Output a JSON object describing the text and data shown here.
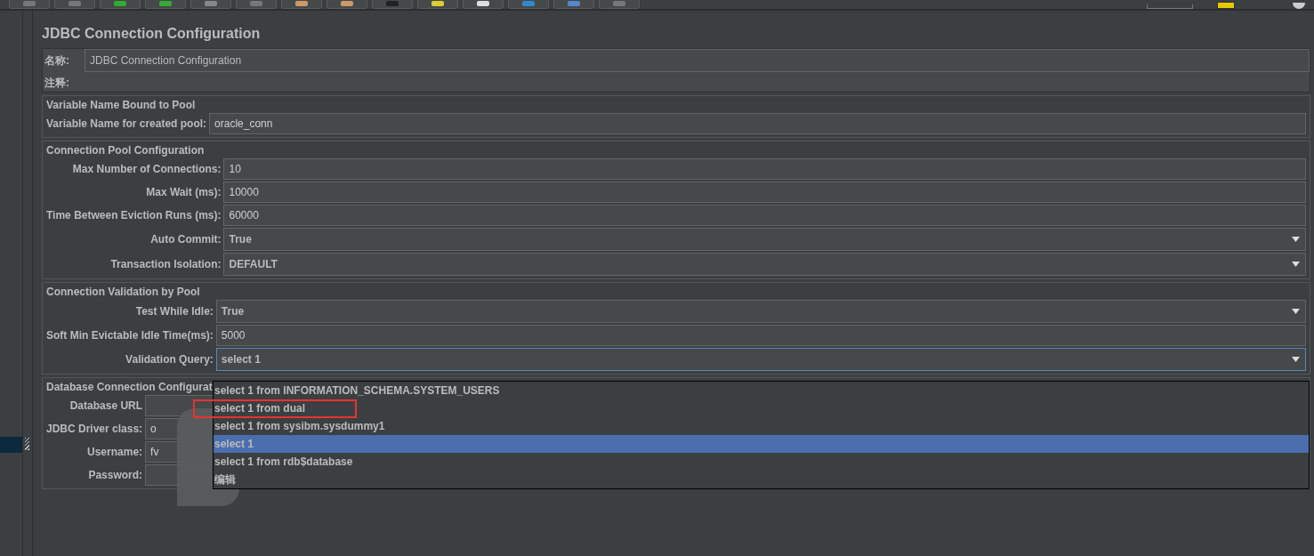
{
  "title": "JDBC Connection Configuration",
  "name_row": {
    "label": "名称:",
    "value": "JDBC Connection Configuration"
  },
  "comment_row": {
    "label": "注释:"
  },
  "sections": [
    {
      "title": "Variable Name Bound to Pool",
      "fields": [
        {
          "label": "Variable Name for created pool:",
          "value": "oracle_conn",
          "kind": "text"
        }
      ]
    },
    {
      "title": "Connection Pool Configuration",
      "fields": [
        {
          "label": "Max Number of Connections:",
          "value": "10",
          "kind": "text"
        },
        {
          "label": "Max Wait (ms):",
          "value": "10000",
          "kind": "text"
        },
        {
          "label": "Time Between Eviction Runs (ms):",
          "value": "60000",
          "kind": "text"
        },
        {
          "label": "Auto Commit:",
          "value": "True",
          "kind": "combo"
        },
        {
          "label": "Transaction Isolation:",
          "value": "DEFAULT",
          "kind": "combo"
        }
      ]
    },
    {
      "title": "Connection Validation by Pool",
      "fields": [
        {
          "label": "Test While Idle:",
          "value": "True",
          "kind": "combo"
        },
        {
          "label": "Soft Min Evictable Idle Time(ms):",
          "value": "5000",
          "kind": "text"
        },
        {
          "label": "Validation Query:",
          "value": "select 1",
          "kind": "combo",
          "focused": true
        }
      ]
    },
    {
      "title": "Database Connection Configurat",
      "fields": [
        {
          "label": "Database URL",
          "kind": "text"
        },
        {
          "label": "JDBC Driver class:",
          "value": "o",
          "kind": "text"
        },
        {
          "label": "Username:",
          "value": "fv",
          "kind": "text"
        },
        {
          "label": "Password:",
          "kind": "text"
        }
      ]
    }
  ],
  "dropdown": {
    "items": [
      {
        "label": "select 1 from INFORMATION_SCHEMA.SYSTEM_USERS",
        "selected": false,
        "marked": false
      },
      {
        "label": "select 1 from dual",
        "selected": false,
        "marked": true
      },
      {
        "label": "select 1 from sysibm.sysdummy1",
        "selected": false,
        "marked": false
      },
      {
        "label": "select 1",
        "selected": true,
        "marked": false
      },
      {
        "label": "select 1 from rdb$database",
        "selected": false,
        "marked": false
      },
      {
        "label": "编辑",
        "selected": false,
        "marked": false
      }
    ]
  }
}
